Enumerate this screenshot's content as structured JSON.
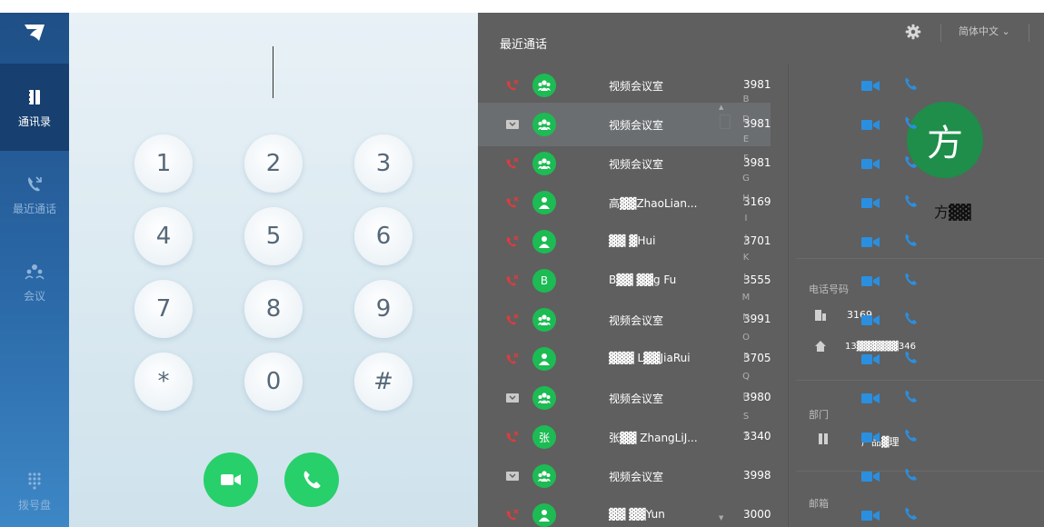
{
  "sidebar": {
    "items": [
      {
        "label": "通讯录"
      },
      {
        "label": "最近通话"
      },
      {
        "label": "会议"
      },
      {
        "label": "拨号盘"
      }
    ]
  },
  "dialer": {
    "keys": [
      "1",
      "2",
      "3",
      "4",
      "5",
      "6",
      "7",
      "8",
      "9",
      "*",
      "0",
      "#"
    ]
  },
  "panel": {
    "title": "最近通话",
    "language": "简体中文 ⌄"
  },
  "calls": [
    {
      "type": "missed",
      "avatar": "group",
      "name": "视频会议室",
      "number": "3981"
    },
    {
      "type": "video",
      "avatar": "group",
      "name": "视频会议室",
      "number": "3981"
    },
    {
      "type": "missed",
      "avatar": "group",
      "name": "视频会议室",
      "number": "3981"
    },
    {
      "type": "missed",
      "avatar": "person",
      "name": "高▓▓ZhaoLian...",
      "number": "3169"
    },
    {
      "type": "missed",
      "avatar": "person",
      "name": "▓▓ ▓Hui",
      "number": "3701"
    },
    {
      "type": "missed",
      "avatar": "B",
      "name": "B▓▓ ▓▓g Fu",
      "number": "3555"
    },
    {
      "type": "missed",
      "avatar": "group",
      "name": "视频会议室",
      "number": "3991"
    },
    {
      "type": "missed",
      "avatar": "person",
      "name": "▓▓▓ L▓▓JiaRui",
      "number": "3705"
    },
    {
      "type": "video-in",
      "avatar": "group",
      "name": "视频会议室",
      "number": "3980"
    },
    {
      "type": "missed",
      "avatar": "张",
      "name": "张▓▓ ZhangLiJ...",
      "number": "3340"
    },
    {
      "type": "video-in",
      "avatar": "group",
      "name": "视频会议室",
      "number": "3998"
    },
    {
      "type": "missed",
      "avatar": "person",
      "name": "▓▓ ▓▓Yun",
      "number": "3000"
    }
  ],
  "alphabet": [
    "B",
    "D",
    "E",
    "F",
    "G",
    "H",
    "I",
    "J",
    "K",
    "L",
    "M",
    "N",
    "O",
    "P",
    "Q",
    "R",
    "S",
    "T"
  ],
  "detail": {
    "avatar_char": "方",
    "name": "方▓▓",
    "phone_label": "电话号码",
    "ext": "3169",
    "mobile": "13▓▓▓▓▓▓346",
    "dept_label": "部门",
    "dept_value": "产品▓理",
    "email_label": "邮箱"
  },
  "colors": {
    "accent_green": "#27d06a",
    "missed_red": "#e03b3b",
    "icon_blue": "#2b8fe0",
    "sidebar_top": "#1f4f86",
    "panel_bg": "#5f5f5f"
  }
}
